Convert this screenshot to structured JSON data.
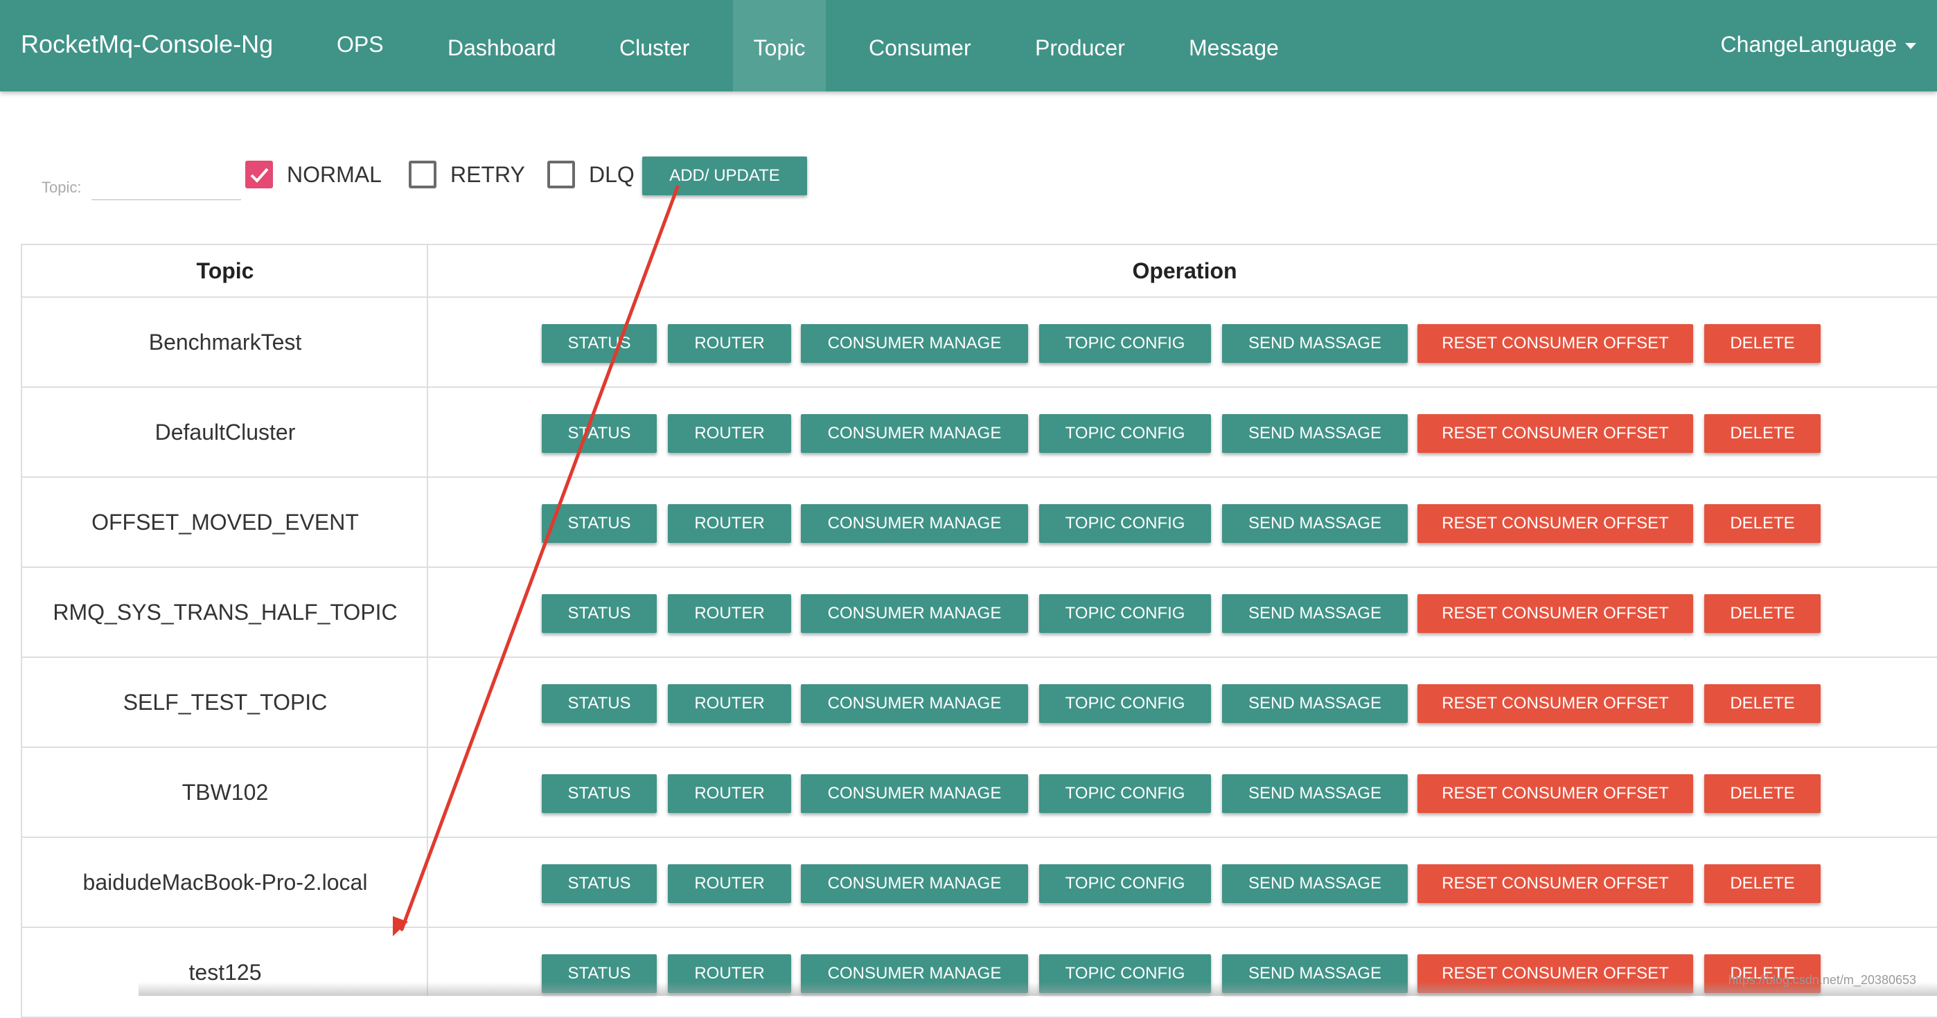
{
  "app": {
    "brand": "RocketMq-Console-Ng",
    "nav": [
      {
        "label": "OPS"
      },
      {
        "label": "Dashboard"
      },
      {
        "label": "Cluster"
      },
      {
        "label": "Topic",
        "active": true
      },
      {
        "label": "Consumer"
      },
      {
        "label": "Producer"
      },
      {
        "label": "Message"
      }
    ],
    "language_menu": "ChangeLanguage"
  },
  "filter": {
    "topic_label": "Topic:",
    "topic_value": "",
    "normal": {
      "label": "NORMAL",
      "checked": true
    },
    "retry": {
      "label": "RETRY",
      "checked": false
    },
    "dlq": {
      "label": "DLQ",
      "checked": false
    },
    "add_update": "ADD/ UPDATE"
  },
  "table": {
    "headers": {
      "topic": "Topic",
      "operation": "Operation"
    },
    "buttons": {
      "status": "STATUS",
      "router": "ROUTER",
      "consumer_manage": "CONSUMER MANAGE",
      "topic_config": "TOPIC CONFIG",
      "send_message": "SEND MASSAGE",
      "reset_offset": "RESET CONSUMER OFFSET",
      "delete": "DELETE"
    },
    "rows": [
      {
        "topic": "BenchmarkTest"
      },
      {
        "topic": "DefaultCluster"
      },
      {
        "topic": "OFFSET_MOVED_EVENT"
      },
      {
        "topic": "RMQ_SYS_TRANS_HALF_TOPIC"
      },
      {
        "topic": "SELF_TEST_TOPIC"
      },
      {
        "topic": "TBW102"
      },
      {
        "topic": "baidudeMacBook-Pro-2.local"
      },
      {
        "topic": "test125"
      }
    ]
  },
  "colors": {
    "primary": "#409387",
    "danger": "#e5533f",
    "checkbox": "#e44a73",
    "annotation": "#e03a2f"
  },
  "watermark": "https://blog.csdn.net/m_20380653"
}
